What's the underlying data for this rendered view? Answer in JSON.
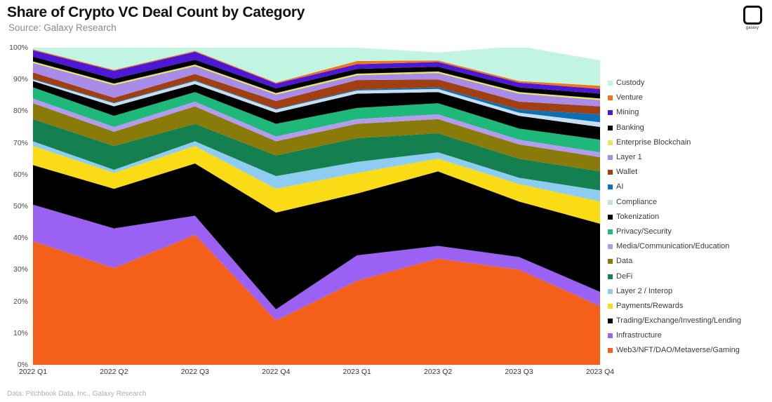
{
  "header": {
    "title": "Share of Crypto VC Deal Count by Category",
    "subtitle": "Source: Galaxy Research"
  },
  "logo": {
    "name": "galaxy-logo",
    "wordmark": "galaxy"
  },
  "footer": {
    "text": "Data: Pitchbook Data, Inc., Galaxy Research"
  },
  "chart_data": {
    "type": "area",
    "title": "Share of Crypto VC Deal Count by Category",
    "subtitle": "Source: Galaxy Research",
    "stacked": true,
    "xlabel": "",
    "ylabel": "",
    "ylim": [
      0,
      100
    ],
    "grid": false,
    "legend_position": "right",
    "y_ticks": [
      "0%",
      "10%",
      "20%",
      "30%",
      "40%",
      "50%",
      "60%",
      "70%",
      "80%",
      "90%",
      "100%"
    ],
    "y_tick_values": [
      0,
      10,
      20,
      30,
      40,
      50,
      60,
      70,
      80,
      90,
      100
    ],
    "categories": [
      "2022 Q1",
      "2022 Q2",
      "2022 Q3",
      "2022 Q4",
      "2023 Q1",
      "2023 Q2",
      "2023 Q3",
      "2023 Q4"
    ],
    "series": [
      {
        "name": "Web3/NFT/DAO/Metaverse/Gaming",
        "color": "#f4601a",
        "values": [
          39.0,
          30.5,
          41.0,
          14.0,
          26.5,
          33.5,
          30.0,
          18.5
        ]
      },
      {
        "name": "Infrastructure",
        "color": "#9b61f2",
        "values": [
          11.5,
          12.5,
          6.0,
          3.5,
          8.0,
          4.0,
          4.0,
          4.5
        ]
      },
      {
        "name": "Trading/Exchange/Investing/Lending",
        "color": "#000000",
        "values": [
          12.5,
          12.5,
          16.5,
          30.5,
          19.5,
          23.5,
          17.5,
          21.5
        ]
      },
      {
        "name": "Payments/Rewards",
        "color": "#fadc16",
        "values": [
          6.0,
          5.0,
          5.5,
          7.5,
          6.5,
          4.0,
          5.5,
          7.0
        ]
      },
      {
        "name": "Layer 2 / Interop",
        "color": "#8ecdf0",
        "values": [
          1.5,
          1.0,
          1.5,
          4.0,
          3.5,
          2.0,
          2.0,
          3.5
        ]
      },
      {
        "name": "DeFi",
        "color": "#147f4f",
        "values": [
          7.0,
          7.5,
          5.5,
          6.5,
          7.5,
          6.0,
          6.0,
          6.0
        ]
      },
      {
        "name": "Data",
        "color": "#897a09",
        "values": [
          5.0,
          4.5,
          5.5,
          4.5,
          4.5,
          4.5,
          4.5,
          4.5
        ]
      },
      {
        "name": "Media/Communication/Education",
        "color": "#b39cef",
        "values": [
          1.5,
          1.5,
          1.5,
          1.5,
          1.5,
          1.5,
          1.5,
          1.5
        ]
      },
      {
        "name": "Privacy/Security",
        "color": "#1db87a",
        "values": [
          3.5,
          3.5,
          3.0,
          4.0,
          3.5,
          3.5,
          3.5,
          4.0
        ]
      },
      {
        "name": "Tokenization",
        "color": "#000000",
        "values": [
          2.0,
          3.0,
          2.5,
          3.5,
          4.5,
          3.5,
          4.0,
          4.0
        ]
      },
      {
        "name": "Compliance",
        "color": "#c5dff0",
        "values": [
          0.5,
          1.0,
          1.0,
          1.0,
          1.0,
          1.0,
          1.0,
          1.5
        ]
      },
      {
        "name": "AI",
        "color": "#0e6fb4",
        "values": [
          0.2,
          0.2,
          0.2,
          0.2,
          0.3,
          0.5,
          1.0,
          2.5
        ]
      },
      {
        "name": "Wallet",
        "color": "#a04012",
        "values": [
          2.0,
          1.5,
          2.0,
          2.5,
          3.0,
          2.5,
          2.5,
          2.5
        ]
      },
      {
        "name": "Layer 1",
        "color": "#a88ce8",
        "values": [
          3.0,
          4.0,
          2.5,
          2.0,
          1.5,
          2.0,
          2.5,
          2.0
        ]
      },
      {
        "name": "Enterprise Blockchain",
        "color": "#e8e65c",
        "values": [
          0.5,
          0.5,
          0.5,
          0.5,
          0.5,
          0.5,
          0.5,
          0.5
        ]
      },
      {
        "name": "Banking",
        "color": "#000000",
        "values": [
          1.5,
          1.5,
          1.5,
          1.5,
          1.5,
          1.5,
          1.5,
          1.5
        ]
      },
      {
        "name": "Mining",
        "color": "#4d17d6",
        "values": [
          2.0,
          2.5,
          2.5,
          1.5,
          1.5,
          1.5,
          1.5,
          1.5
        ]
      },
      {
        "name": "Venture",
        "color": "#f0741c",
        "values": [
          0.3,
          0.3,
          0.3,
          0.3,
          1.0,
          0.5,
          0.5,
          1.0
        ]
      },
      {
        "name": "Custody",
        "color": "#c2f5e1",
        "values": [
          0.5,
          7.0,
          1.0,
          11.0,
          4.2,
          2.5,
          11.0,
          8.0
        ]
      }
    ],
    "legend": [
      {
        "label": "Custody",
        "color": "#c2f5e1"
      },
      {
        "label": "Venture",
        "color": "#f0741c"
      },
      {
        "label": "Mining",
        "color": "#4d17d6"
      },
      {
        "label": "Banking",
        "color": "#000000"
      },
      {
        "label": "Enterprise Blockchain",
        "color": "#e8e65c"
      },
      {
        "label": "Layer 1",
        "color": "#a88ce8"
      },
      {
        "label": "Wallet",
        "color": "#a04012"
      },
      {
        "label": "AI",
        "color": "#0e6fb4"
      },
      {
        "label": "Compliance",
        "color": "#c5dff0"
      },
      {
        "label": "Tokenization",
        "color": "#000000"
      },
      {
        "label": "Privacy/Security",
        "color": "#1db87a"
      },
      {
        "label": "Media/Communication/Education",
        "color": "#b39cef"
      },
      {
        "label": "Data",
        "color": "#897a09"
      },
      {
        "label": "DeFi",
        "color": "#147f4f"
      },
      {
        "label": "Layer 2 / Interop",
        "color": "#8ecdf0"
      },
      {
        "label": "Payments/Rewards",
        "color": "#fadc16"
      },
      {
        "label": "Trading/Exchange/Investing/Lending",
        "color": "#000000"
      },
      {
        "label": "Infrastructure",
        "color": "#9b61f2"
      },
      {
        "label": "Web3/NFT/DAO/Metaverse/Gaming",
        "color": "#f4601a"
      }
    ]
  }
}
